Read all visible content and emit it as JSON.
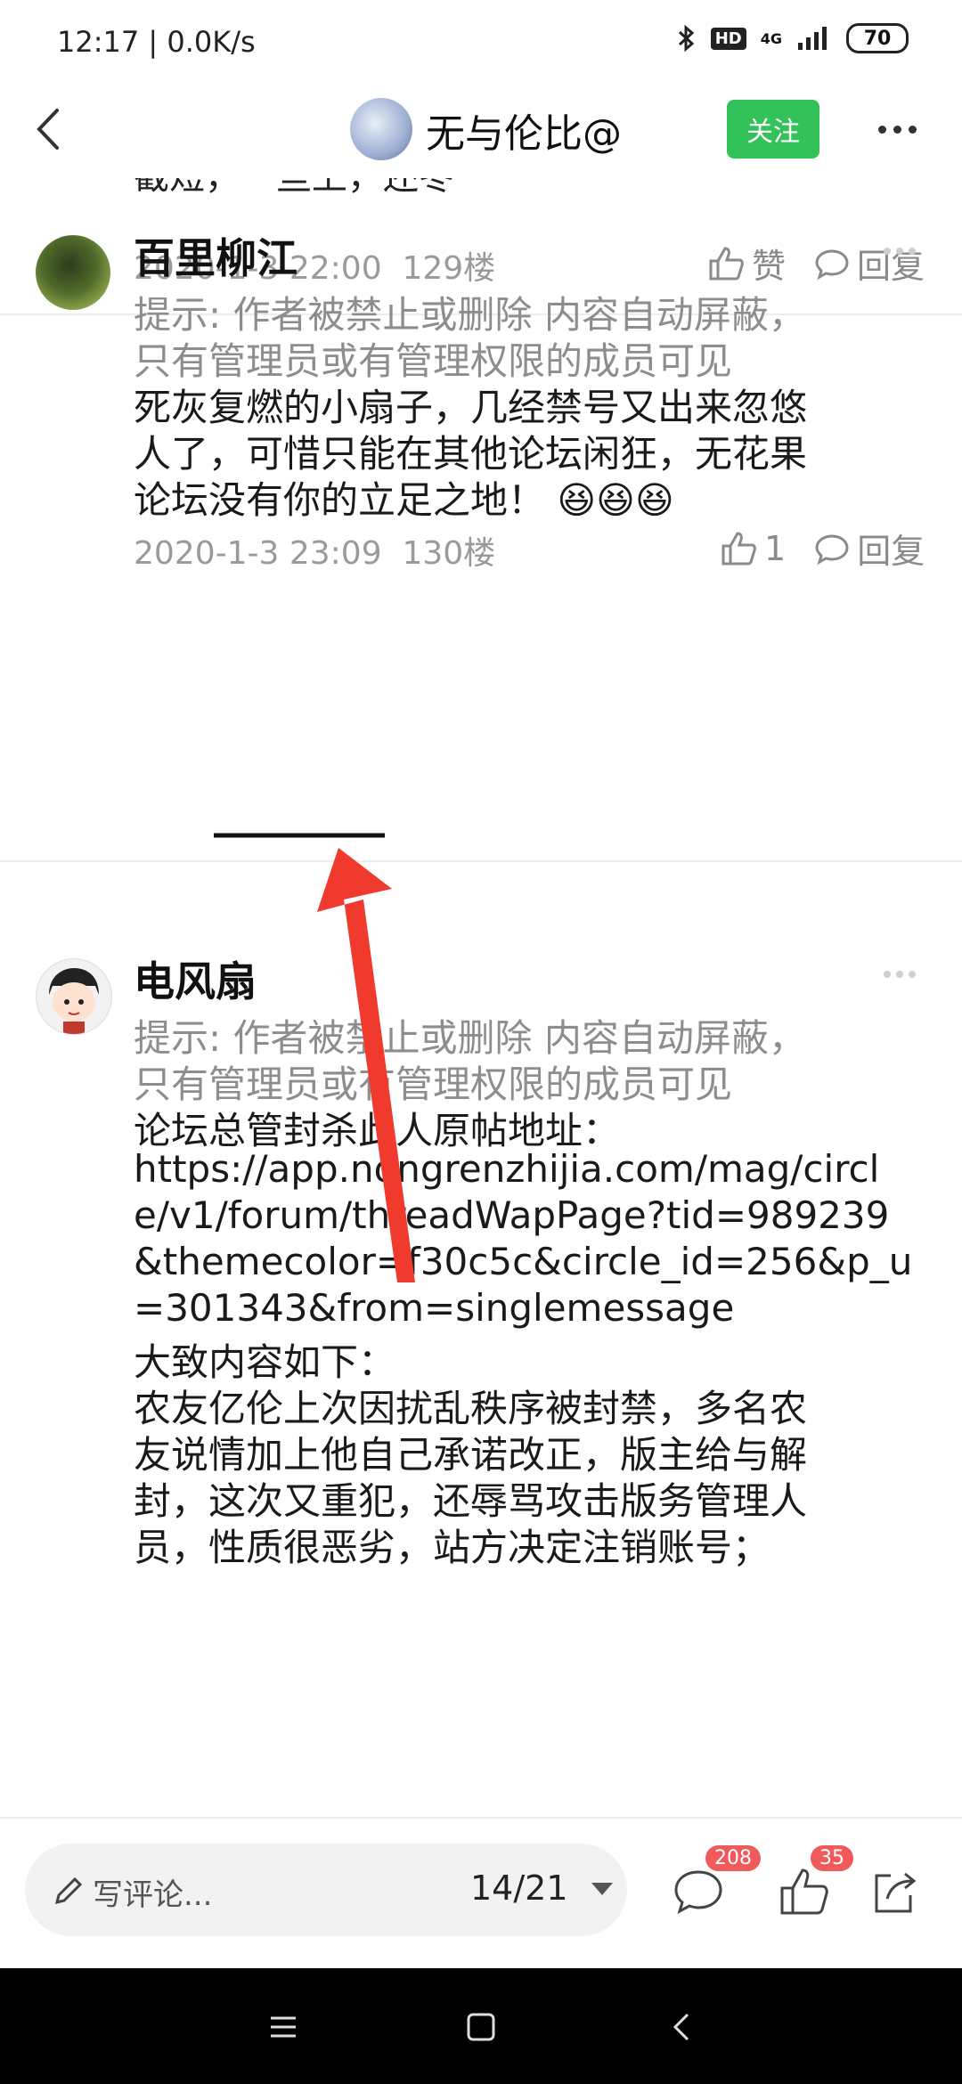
{
  "status": {
    "time": "12:17 | 0.0K/s",
    "hd": "HD",
    "network": "4G",
    "battery": "70"
  },
  "nav": {
    "title": "无与伦比@",
    "follow_label": "关注"
  },
  "cutoff_text": "截短，一些上，还冬",
  "posts": [
    {
      "date": "2020-1-3 22:00",
      "floor": "129楼",
      "like_label": "赞",
      "reply_label": "回复"
    },
    {
      "username": "百里柳江",
      "notice_line1": "提示: 作者被禁止或删除 内容自动屏蔽，",
      "notice_line2": "只有管理员或有管理权限的成员可见",
      "lines": [
        "死灰复燃的小扇子，几经禁号又出来忽悠",
        "人了，可惜只能在其他论坛闲狂，无花果",
        "论坛没有你的立足之地！"
      ],
      "emoji": "😆😆😆",
      "date": "2020-1-3 23:09",
      "floor": "130楼",
      "like_count": "1",
      "reply_label": "回复"
    },
    {
      "username": "电风扇",
      "notice_line1": "提示: 作者被禁止或删除 内容自动屏蔽，",
      "notice_line2": "只有管理员或有管理权限的成员可见",
      "lines": [
        "论坛总管封杀此人原帖地址：",
        "https://app.nongrenzhijia.com/mag/circl",
        "e/v1/forum/threadWapPage?tid=989239",
        "&themecolor=f30c5c&circle_id=256&p_u",
        "=301343&from=singlemessage",
        "大致内容如下：",
        "农友亿伦上次因扰乱秩序被封禁，多名农",
        "友说情加上他自己承诺改正，版主给与解",
        "封，这次又重犯，还辱骂攻击版务管理人",
        "员，性质很恶劣，站方决定注销账号；"
      ]
    }
  ],
  "bottom": {
    "comment_placeholder": "写评论...",
    "page": "14/21",
    "comment_count": "208",
    "like_count": "35"
  },
  "icons": [
    "back-icon",
    "more-icon",
    "thumb-up-icon",
    "reply-icon",
    "pencil-icon",
    "share-icon",
    "menu-icon",
    "home-icon",
    "back-sys-icon"
  ],
  "colors": {
    "follow": "#33c15a",
    "badge": "#f05a5a",
    "arrow": "#f03a2e"
  }
}
